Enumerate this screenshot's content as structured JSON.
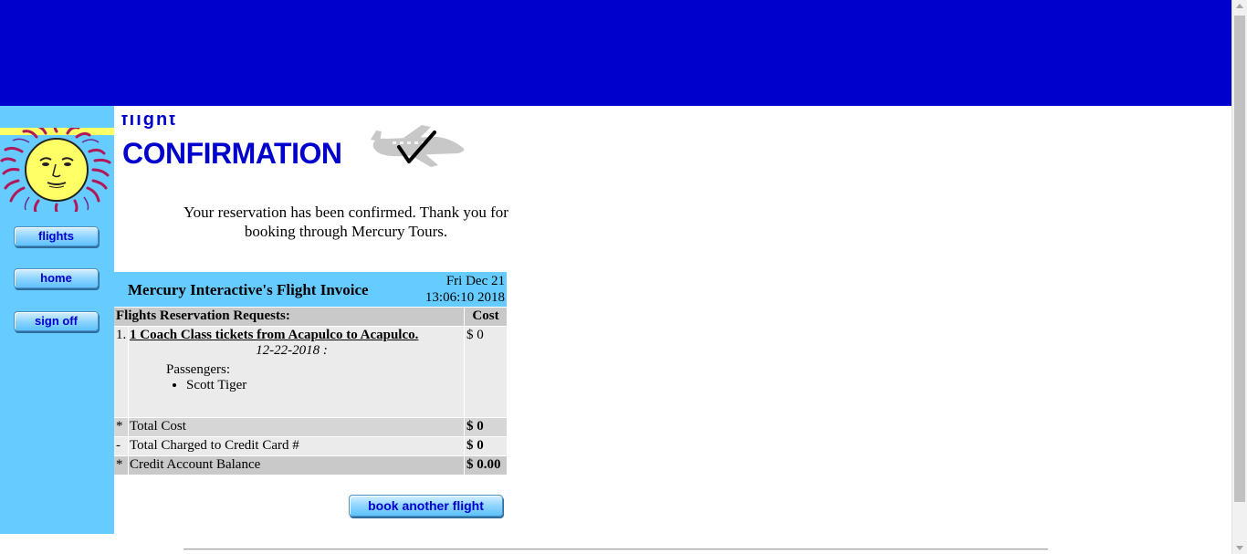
{
  "colors": {
    "top_banner": "#0000cc",
    "sidebar": "#66ccff",
    "heading": "#0000cc",
    "table_header": "#c9c9c9"
  },
  "nav": {
    "flights": "flights",
    "home": "home",
    "sign_off": "sign off"
  },
  "page": {
    "heading_small": "flight",
    "heading": "CONFIRMATION",
    "message": "Your reservation has been confirmed. Thank you for booking through Mercury Tours."
  },
  "invoice": {
    "title": "Mercury Interactive's Flight Invoice",
    "date": "Fri Dec 21",
    "time": "13:06:10 2018",
    "requests_header": "Flights Reservation Requests:",
    "cost_header": "Cost",
    "item": {
      "number": "1.",
      "description": "1 Coach Class tickets from Acapulco to Acapulco.",
      "date_line": "12-22-2018 :",
      "passengers_label": "Passengers:",
      "passengers": [
        "Scott Tiger"
      ],
      "cost": "$ 0"
    },
    "totals": [
      {
        "marker": "*",
        "label": "Total Cost",
        "value": "$ 0"
      },
      {
        "marker": "-",
        "label": "Total Charged to Credit Card #",
        "value": "$ 0"
      },
      {
        "marker": "*",
        "label": "Credit Account Balance",
        "value": "$ 0.00"
      }
    ]
  },
  "actions": {
    "book_another": "book another flight"
  }
}
